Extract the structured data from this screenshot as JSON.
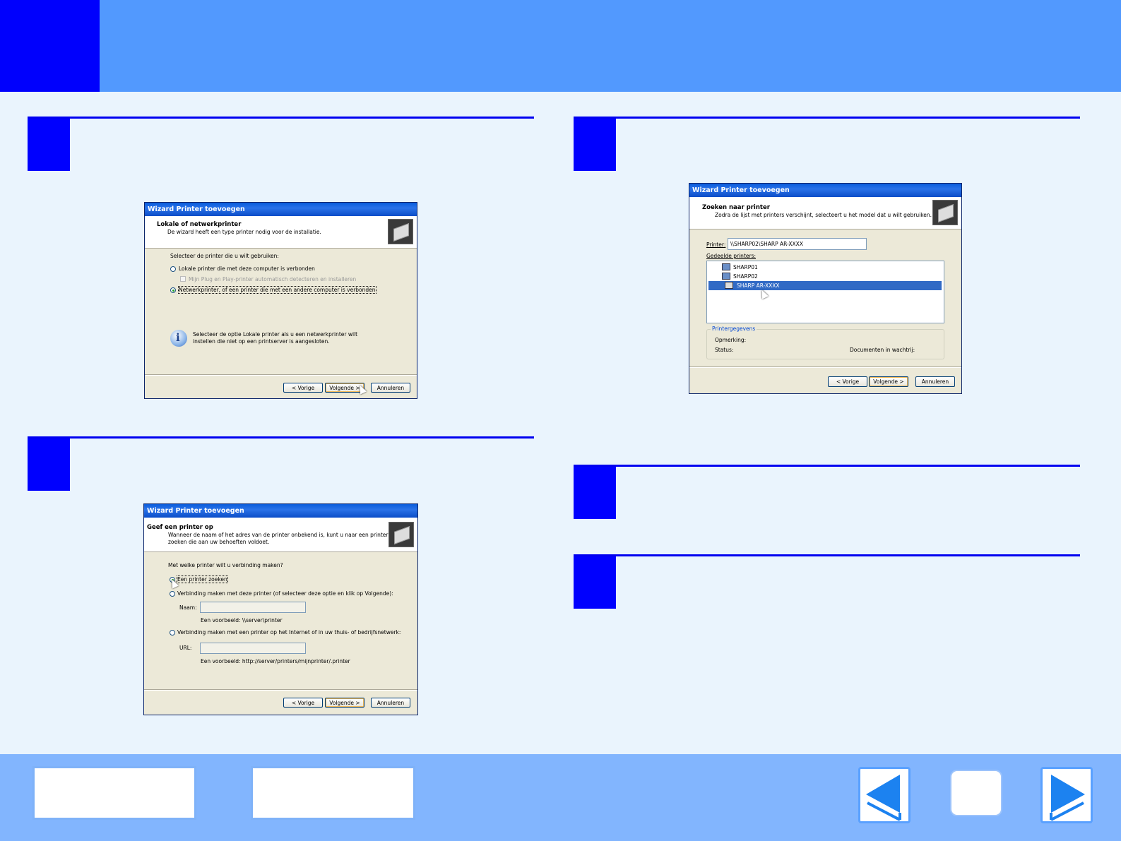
{
  "dialog1": {
    "title": "Wizard Printer toevoegen",
    "heading": "Lokale of netwerkprinter",
    "subtitle": "De wizard heeft een type printer nodig voor de installatie.",
    "question": "Selecteer de printer die u wilt gebruiken:",
    "opt_local": "Lokale printer die met deze computer is verbonden",
    "opt_pnp": "Mijn Plug en Play-printer automatisch detecteren en installeren",
    "opt_network": "Netwerkprinter, of een printer die met een andere computer is verbonden",
    "info_line1": "Selecteer de optie Lokale printer als u een netwerkprinter wilt",
    "info_line2": "instellen die niet op een printserver is aangesloten.",
    "btn_back": "< Vorige",
    "btn_next": "Volgende >",
    "btn_cancel": "Annuleren"
  },
  "dialog2": {
    "title": "Wizard Printer toevoegen",
    "heading": "Geef een printer op",
    "subtitle_line1": "Wanneer de naam of het adres van de printer onbekend is, kunt u naar een printer",
    "subtitle_line2": "zoeken die aan uw behoeften voldoet.",
    "question": "Met welke printer wilt u verbinding maken?",
    "opt_search": "Een printer zoeken",
    "opt_connect": "Verbinding maken met deze printer (of selecteer deze optie en klik op Volgende):",
    "name_label": "Naam:",
    "name_example": "Een voorbeeld: \\\\server\\printer",
    "opt_url": "Verbinding maken met een printer op het Internet of in uw thuis- of bedrijfsnetwerk:",
    "url_label": "URL:",
    "url_example": "Een voorbeeld: http://server/printers/mijnprinter/.printer",
    "btn_back": "< Vorige",
    "btn_next": "Volgende >",
    "btn_cancel": "Annuleren"
  },
  "dialog3": {
    "title": "Wizard Printer toevoegen",
    "heading": "Zoeken naar printer",
    "subtitle": "Zodra de lijst met printers verschijnt, selecteert u het model dat u wilt gebruiken.",
    "printer_label": "Printer:",
    "printer_value": "\\\\SHARP02\\SHARP AR-XXXX",
    "shared_label": "Gedeelde printers:",
    "tree": [
      "SHARP01",
      "SHARP02",
      "SHARP AR-XXXX"
    ],
    "group_label": "Printergegevens",
    "comment_label": "Opmerking:",
    "status_label": "Status:",
    "status_value": "Documenten in wachtrij:",
    "btn_back": "< Vorige",
    "btn_next": "Volgende >",
    "btn_cancel": "Annuleren"
  },
  "colors": {
    "header": "#5299fe",
    "step_marker": "#0000fe",
    "footer": "#82b5fe",
    "background": "#eaf4fd"
  },
  "icons": [
    "printer-icon",
    "info-icon",
    "mouse-cursor-icon",
    "computer-icon",
    "arrow-left-icon",
    "arrow-right-icon"
  ]
}
